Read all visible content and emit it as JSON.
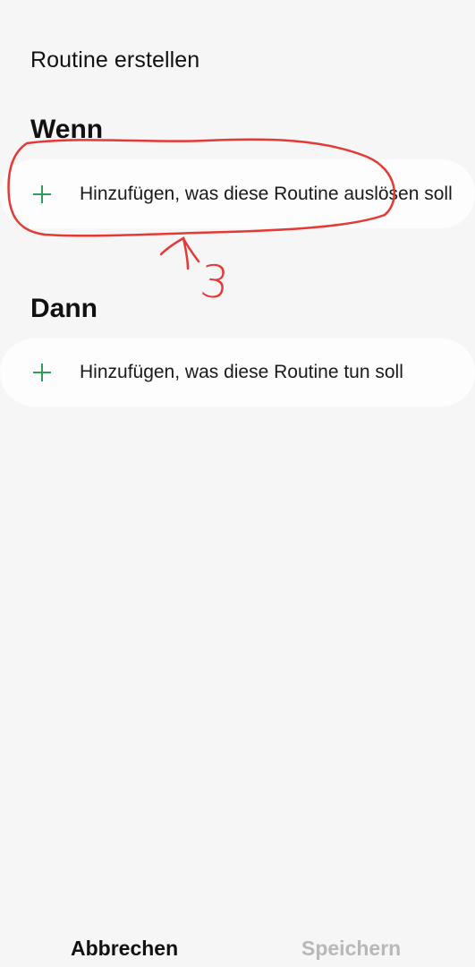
{
  "header": {
    "title": "Routine erstellen"
  },
  "sections": {
    "when": {
      "heading": "Wenn",
      "add_label": "Hinzufügen, was diese Routine auslösen soll"
    },
    "then": {
      "heading": "Dann",
      "add_label": "Hinzufügen, was diese Routine tun soll"
    }
  },
  "annotation": {
    "number": "3",
    "color": "#e53935"
  },
  "footer": {
    "cancel_label": "Abbrechen",
    "save_label": "Speichern"
  },
  "colors": {
    "background": "#f6f6f6",
    "card": "#fdfdfd",
    "plus": "#2e9d5c",
    "disabled": "#b8b8b8"
  },
  "icons": {
    "add": "plus-icon"
  }
}
